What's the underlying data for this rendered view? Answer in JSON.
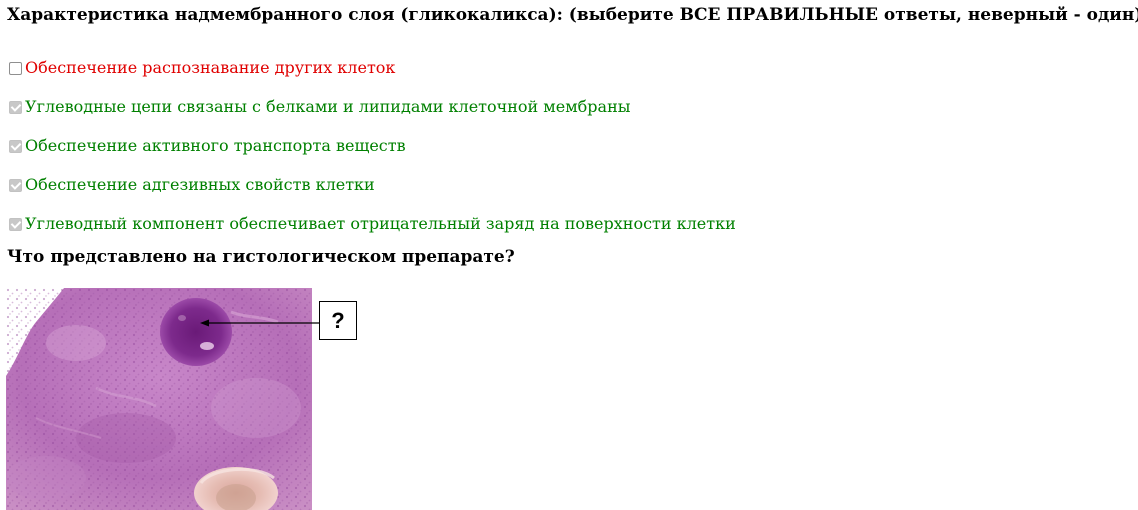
{
  "question1": {
    "title": "Характеристика надмембранного слоя (гликокаликса): (выберите ВСЕ ПРАВИЛЬНЫЕ ответы, неверный - один)",
    "options": [
      {
        "label": "Обеспечение распознавание других клеток",
        "checked": false,
        "status": "wrong",
        "color": "#e00000"
      },
      {
        "label": "Углеводные цепи связаны с белками и липидами клеточной мембраны",
        "checked": true,
        "status": "correct",
        "color": "#008000"
      },
      {
        "label": "Обеспечение активного транспорта веществ",
        "checked": true,
        "status": "correct",
        "color": "#008000"
      },
      {
        "label": "Обеспечение адгезивных свойств клетки",
        "checked": true,
        "status": "correct",
        "color": "#008000"
      },
      {
        "label": "Углеводный компонент обеспечивает отрицательный заряд на поверхности клетки",
        "checked": true,
        "status": "correct",
        "color": "#008000"
      }
    ]
  },
  "question2": {
    "title": "Что представлено на гистологическом препарате?",
    "figure": {
      "callout_label": "?",
      "image_subject": "histology-slide"
    }
  }
}
